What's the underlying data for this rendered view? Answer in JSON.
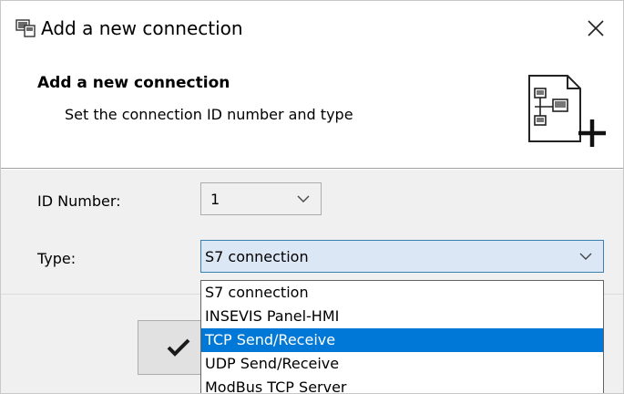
{
  "window": {
    "title": "Add a new connection",
    "icons": {
      "app": "connection-window-icon",
      "close": "close-icon"
    }
  },
  "header": {
    "title": "Add a new connection",
    "subtitle": "Set the connection ID number and type",
    "icon": "new-connection-network-icon"
  },
  "form": {
    "id_label": "ID Number:",
    "id_value": "1",
    "type_label": "Type:",
    "type_value": "S7 connection"
  },
  "dropdown": {
    "options": [
      "S7 connection",
      "INSEVIS Panel-HMI",
      "TCP Send/Receive",
      "UDP Send/Receive",
      "ModBus TCP Server"
    ],
    "highlighted": "TCP Send/Receive"
  },
  "footer": {
    "ok_icon": "checkmark-icon"
  },
  "colors": {
    "selection": "#0078d7",
    "combo_focus_bg": "#dbe7f5",
    "combo_focus_border": "#3c7fb1",
    "dialog_bg": "#f0f0f0"
  }
}
